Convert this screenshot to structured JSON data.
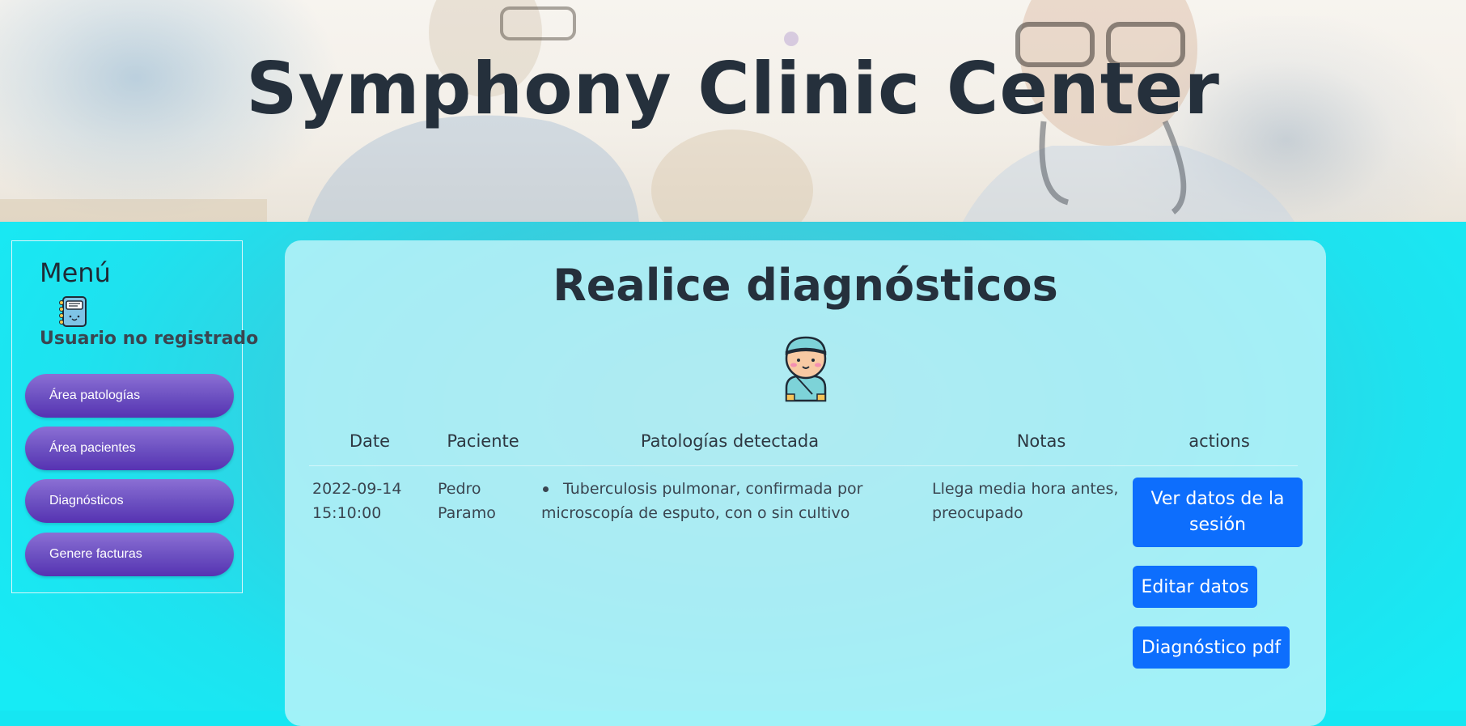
{
  "header": {
    "title": "Symphony Clinic Center"
  },
  "sidebar": {
    "title": "Menú",
    "user_status": "Usuario no registrado",
    "items": [
      {
        "label": "Área patologías"
      },
      {
        "label": "Área pacientes"
      },
      {
        "label": "Diagnósticos"
      },
      {
        "label": "Genere facturas"
      }
    ]
  },
  "main": {
    "title": "Realice diagnósticos",
    "table": {
      "columns": [
        "Date",
        "Paciente",
        "Patologías detectada",
        "Notas",
        "actions"
      ],
      "rows": [
        {
          "date_line1": "2022-09-14",
          "date_line2": "15:10:00",
          "patient_line1": "Pedro",
          "patient_line2": "Paramo",
          "pathology_line1": "Tuberculosis pulmonar, confirmada por",
          "pathology_line2": "microscopía de esputo, con o sin cultivo",
          "notes_line1": "Llega media hora antes,",
          "notes_line2": "preocupado",
          "actions": {
            "view_line1": "Ver datos de la",
            "view_line2": "sesión",
            "edit": "Editar datos",
            "pdf": "Diagnóstico pdf"
          }
        }
      ]
    }
  },
  "colors": {
    "nav_button": "#6b4fc0",
    "action_button": "#0d6efd",
    "page_background": "#16e6f2"
  }
}
